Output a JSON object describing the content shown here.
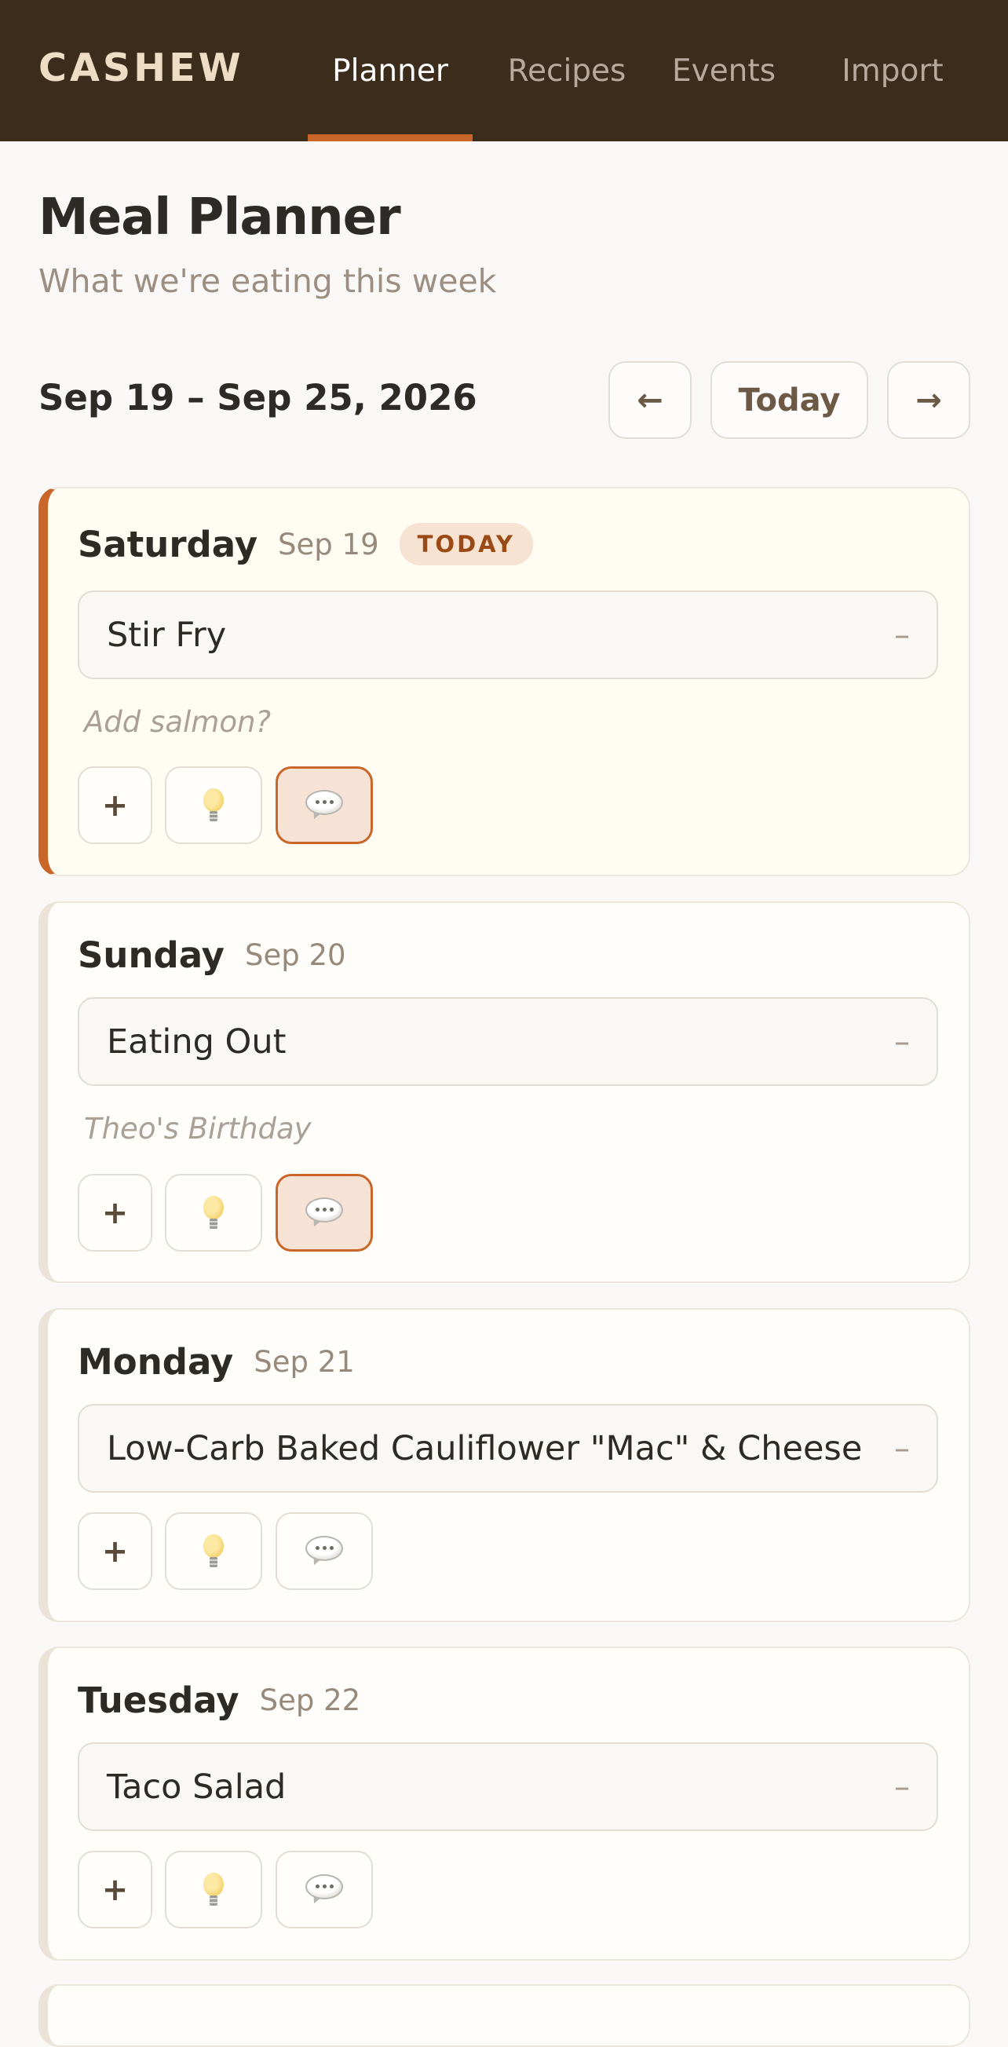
{
  "app": {
    "brand": "CASHEW",
    "nav": [
      {
        "label": "Planner",
        "active": true
      },
      {
        "label": "Recipes",
        "active": false
      },
      {
        "label": "Events",
        "active": false
      },
      {
        "label": "Import",
        "active": false
      }
    ]
  },
  "header": {
    "title": "Meal Planner",
    "subtitle": "What we're eating this week"
  },
  "week": {
    "range": "Sep 19 – Sep 25, 2026",
    "prev_label": "←",
    "today_label": "Today",
    "next_label": "→"
  },
  "days": [
    {
      "name": "Saturday",
      "date": "Sep 19",
      "badge": "TODAY",
      "meal": "Stir Fry",
      "note": "Add salmon?",
      "note_active": true
    },
    {
      "name": "Sunday",
      "date": "Sep 20",
      "meal": "Eating Out",
      "note": "Theo's Birthday",
      "note_active": true
    },
    {
      "name": "Monday",
      "date": "Sep 21",
      "meal": "Low-Carb Baked Cauliflower \"Mac\" & Cheese",
      "note_active": false
    },
    {
      "name": "Tuesday",
      "date": "Sep 22",
      "meal": "Taco Salad",
      "note_active": false
    }
  ],
  "actions": {
    "add_label": "+",
    "remove_label": "–",
    "idea_icon": "lightbulb-icon",
    "note_icon": "speech-bubble-icon"
  },
  "colors": {
    "topbar": "#3b2c1b",
    "accent": "#c9672a",
    "brand": "#efdcc5"
  }
}
